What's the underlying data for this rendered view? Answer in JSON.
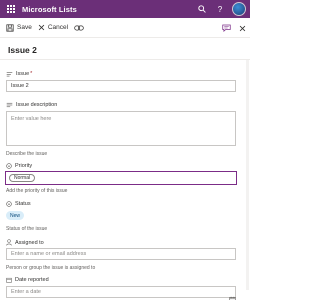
{
  "app": {
    "title": "Microsoft Lists"
  },
  "topbar": {
    "icons": [
      "waffle-icon",
      "search-icon",
      "help-icon",
      "avatar"
    ]
  },
  "commands": {
    "save": "Save",
    "cancel": "Cancel",
    "icons": [
      "save-icon",
      "close-icon",
      "link-icon",
      "comment-icon",
      "dismiss-icon"
    ]
  },
  "form": {
    "title": "Issue 2",
    "issue": {
      "label": "Issue",
      "required": "*",
      "value": "Issue 2"
    },
    "description": {
      "label": "Issue description",
      "placeholder": "Enter value here",
      "help": "Describe the issue"
    },
    "priority": {
      "label": "Priority",
      "value": "Normal",
      "help": "Add the priority of this issue"
    },
    "status": {
      "label": "Status",
      "value": "New",
      "help": "Status of the issue"
    },
    "assigned": {
      "label": "Assigned to",
      "placeholder": "Enter a name or email address",
      "help": "Person or group the issue is assigned to"
    },
    "date": {
      "label": "Date reported",
      "placeholder": "Enter a date"
    }
  },
  "colors": {
    "brand": "#6b2f78",
    "focus_border": "#7b2c87",
    "status_pill": "#d9edf9"
  }
}
